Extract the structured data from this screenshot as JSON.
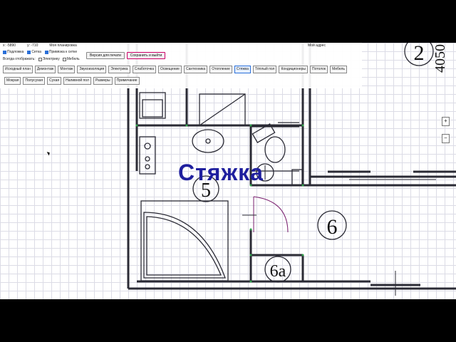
{
  "status": {
    "x_coord": "x: -5890",
    "y_coord": "y: -710",
    "plan_name": "Моя планировка",
    "address": "Мой адрес"
  },
  "options": {
    "underlay": "Подложка",
    "grid": "Сетка",
    "snap": "Привязка к сетке",
    "always_show": "Всегда отображать:",
    "electrics": "Электрику",
    "furniture": "Мебель"
  },
  "actions": {
    "print": "Версия для печати",
    "save_exit": "Сохранить и выйти"
  },
  "stages": [
    "Исходный план",
    "Демонтаж",
    "Монтаж",
    "Звукоизоляция",
    "Электрика",
    "Слаботочка",
    "Освещение",
    "Сантехника",
    "Отопление",
    "Стяжка",
    "Тёплый пол",
    "Кондиционеры",
    "Потолок",
    "Мебель"
  ],
  "active_stage": "Стяжка",
  "sub_stages": [
    "Мокрая",
    "Полусухая",
    "Сухая",
    "Наливной пол",
    "Размеры",
    "Примечание"
  ],
  "overlay_title": "Стяжка",
  "rooms": {
    "r2": "2",
    "r5": "5",
    "r6": "6",
    "r6a": "6а",
    "dim": "4050"
  },
  "zoom": {
    "plus": "+",
    "minus": "−"
  },
  "colors": {
    "accent": "#1f1f9e",
    "wall": "#2b2b35",
    "pipe": "#7a1f6e"
  }
}
